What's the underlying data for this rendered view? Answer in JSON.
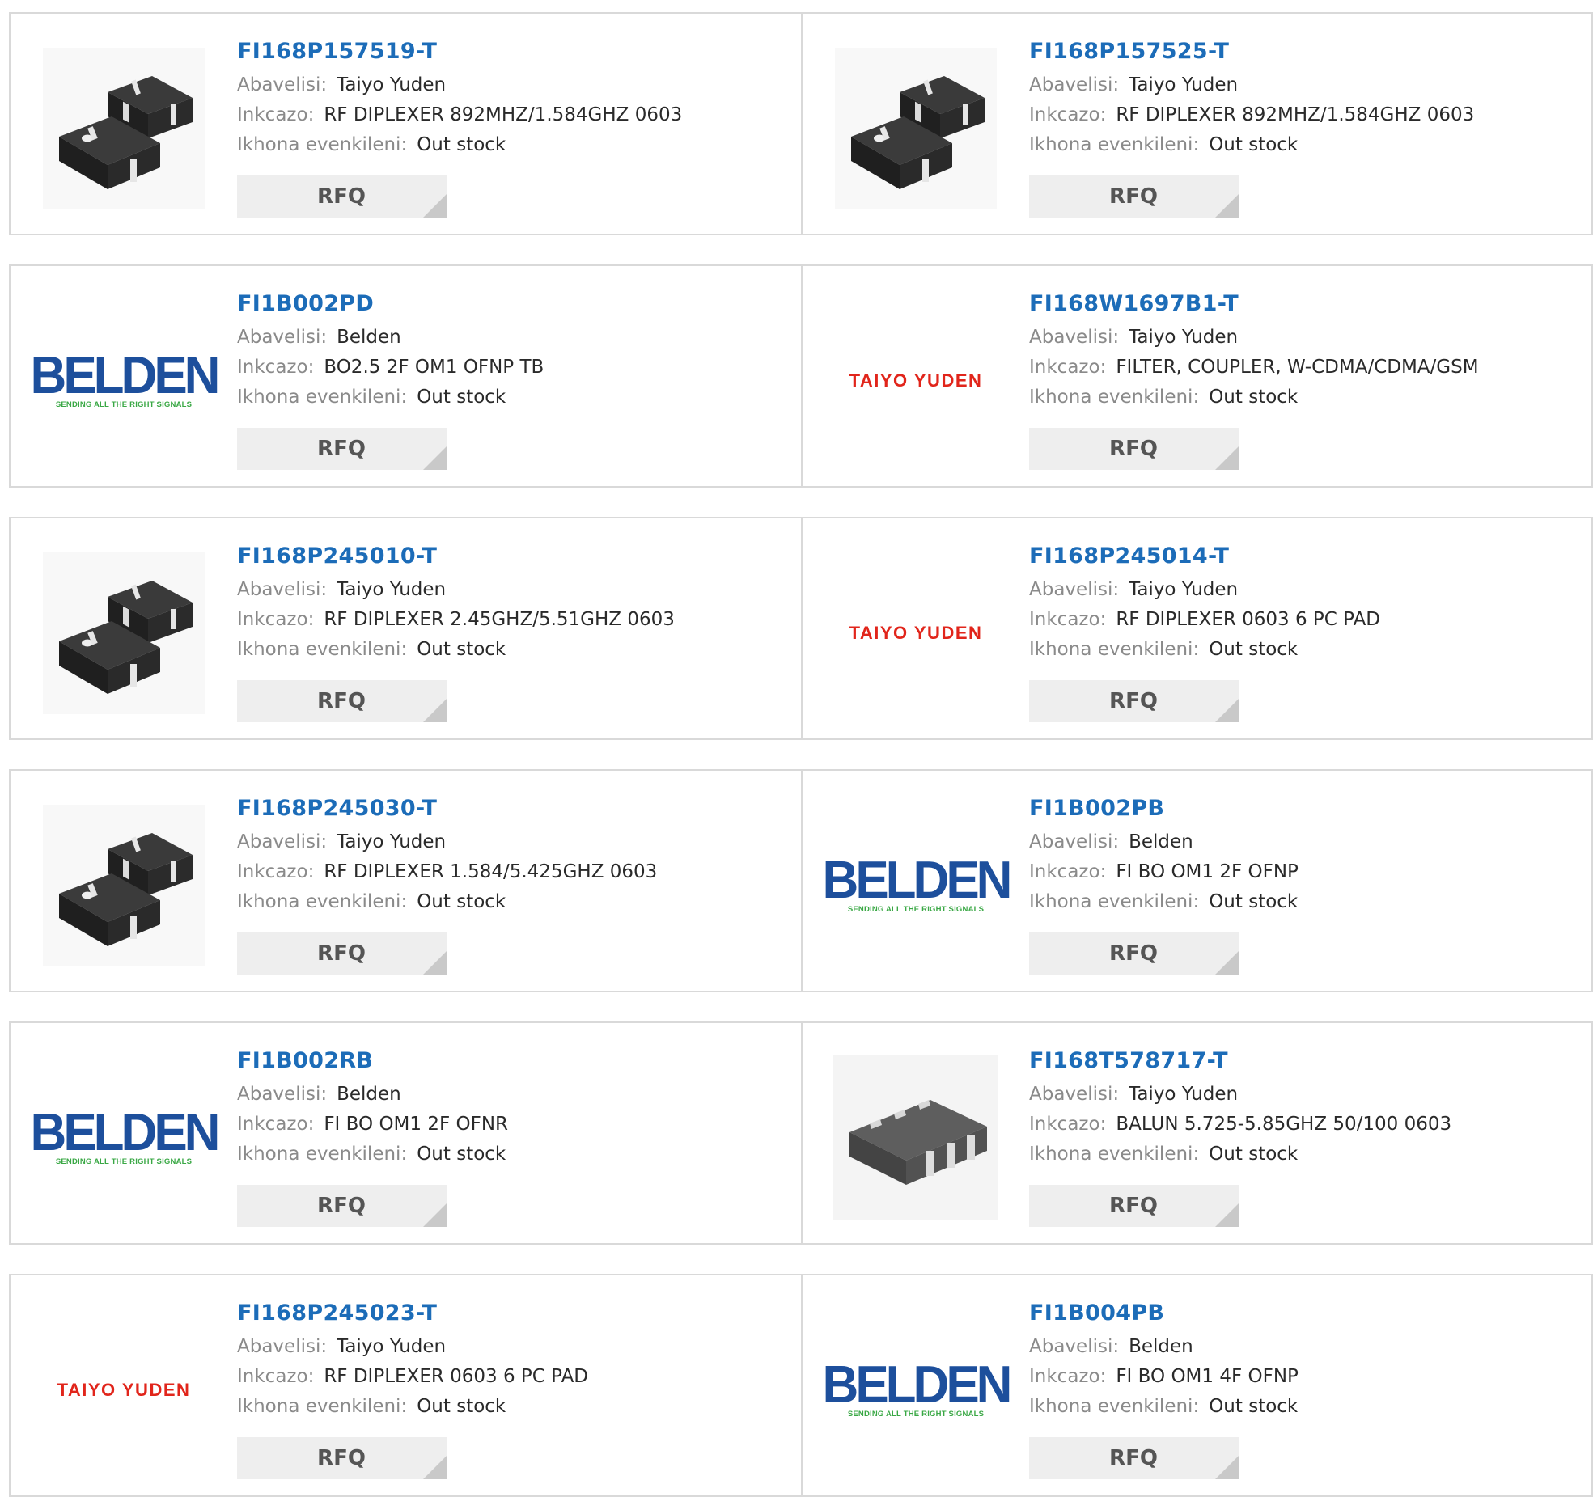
{
  "labels": {
    "manufacturer": "Abavelisi:",
    "description": "Inkcazo:",
    "stock": "Ikhona evenkileni:",
    "rfq": "RFQ"
  },
  "logos": {
    "belden_word": "BELDEN",
    "belden_tag": "SENDING ALL THE RIGHT SIGNALS",
    "taiyo": "TAIYO YUDEN"
  },
  "products": [
    {
      "part": "FI168P157519-T",
      "manufacturer": "Taiyo Yuden",
      "description": "RF DIPLEXER 892MHZ/1.584GHZ 0603",
      "stock": "Out stock",
      "image": "diplexer-chip-icon"
    },
    {
      "part": "FI168P157525-T",
      "manufacturer": "Taiyo Yuden",
      "description": "RF DIPLEXER 892MHZ/1.584GHZ 0603",
      "stock": "Out stock",
      "image": "diplexer-chip-icon"
    },
    {
      "part": "FI1B002PD",
      "manufacturer": "Belden",
      "description": "BO2.5 2F OM1 OFNP TB",
      "stock": "Out stock",
      "image": "belden-logo"
    },
    {
      "part": "FI168W1697B1-T",
      "manufacturer": "Taiyo Yuden",
      "description": "FILTER, COUPLER, W-CDMA/CDMA/GSM",
      "stock": "Out stock",
      "image": "taiyo-yuden-logo"
    },
    {
      "part": "FI168P245010-T",
      "manufacturer": "Taiyo Yuden",
      "description": "RF DIPLEXER 2.45GHZ/5.51GHZ 0603",
      "stock": "Out stock",
      "image": "diplexer-chip-icon"
    },
    {
      "part": "FI168P245014-T",
      "manufacturer": "Taiyo Yuden",
      "description": "RF DIPLEXER 0603 6 PC PAD",
      "stock": "Out stock",
      "image": "taiyo-yuden-logo"
    },
    {
      "part": "FI168P245030-T",
      "manufacturer": "Taiyo Yuden",
      "description": "RF DIPLEXER 1.584/5.425GHZ 0603",
      "stock": "Out stock",
      "image": "diplexer-chip-icon"
    },
    {
      "part": "FI1B002PB",
      "manufacturer": "Belden",
      "description": "FI BO OM1 2F OFNP",
      "stock": "Out stock",
      "image": "belden-logo"
    },
    {
      "part": "FI1B002RB",
      "manufacturer": "Belden",
      "description": "FI BO OM1 2F OFNR",
      "stock": "Out stock",
      "image": "belden-logo"
    },
    {
      "part": "FI168T578717-T",
      "manufacturer": "Taiyo Yuden",
      "description": "BALUN 5.725-5.85GHZ 50/100 0603",
      "stock": "Out stock",
      "image": "balun-chip-icon"
    },
    {
      "part": "FI168P245023-T",
      "manufacturer": "Taiyo Yuden",
      "description": "RF DIPLEXER 0603 6 PC PAD",
      "stock": "Out stock",
      "image": "taiyo-yuden-logo"
    },
    {
      "part": "FI1B004PB",
      "manufacturer": "Belden",
      "description": "FI BO OM1 4F OFNP",
      "stock": "Out stock",
      "image": "belden-logo"
    }
  ],
  "colors": {
    "part_link": "#1c6cb8",
    "border": "#d9d9d9",
    "rfq_bg": "#eeeeee",
    "belden_blue": "#1d4f9c",
    "belden_green": "#3aa845",
    "taiyo_red": "#e1251b"
  }
}
